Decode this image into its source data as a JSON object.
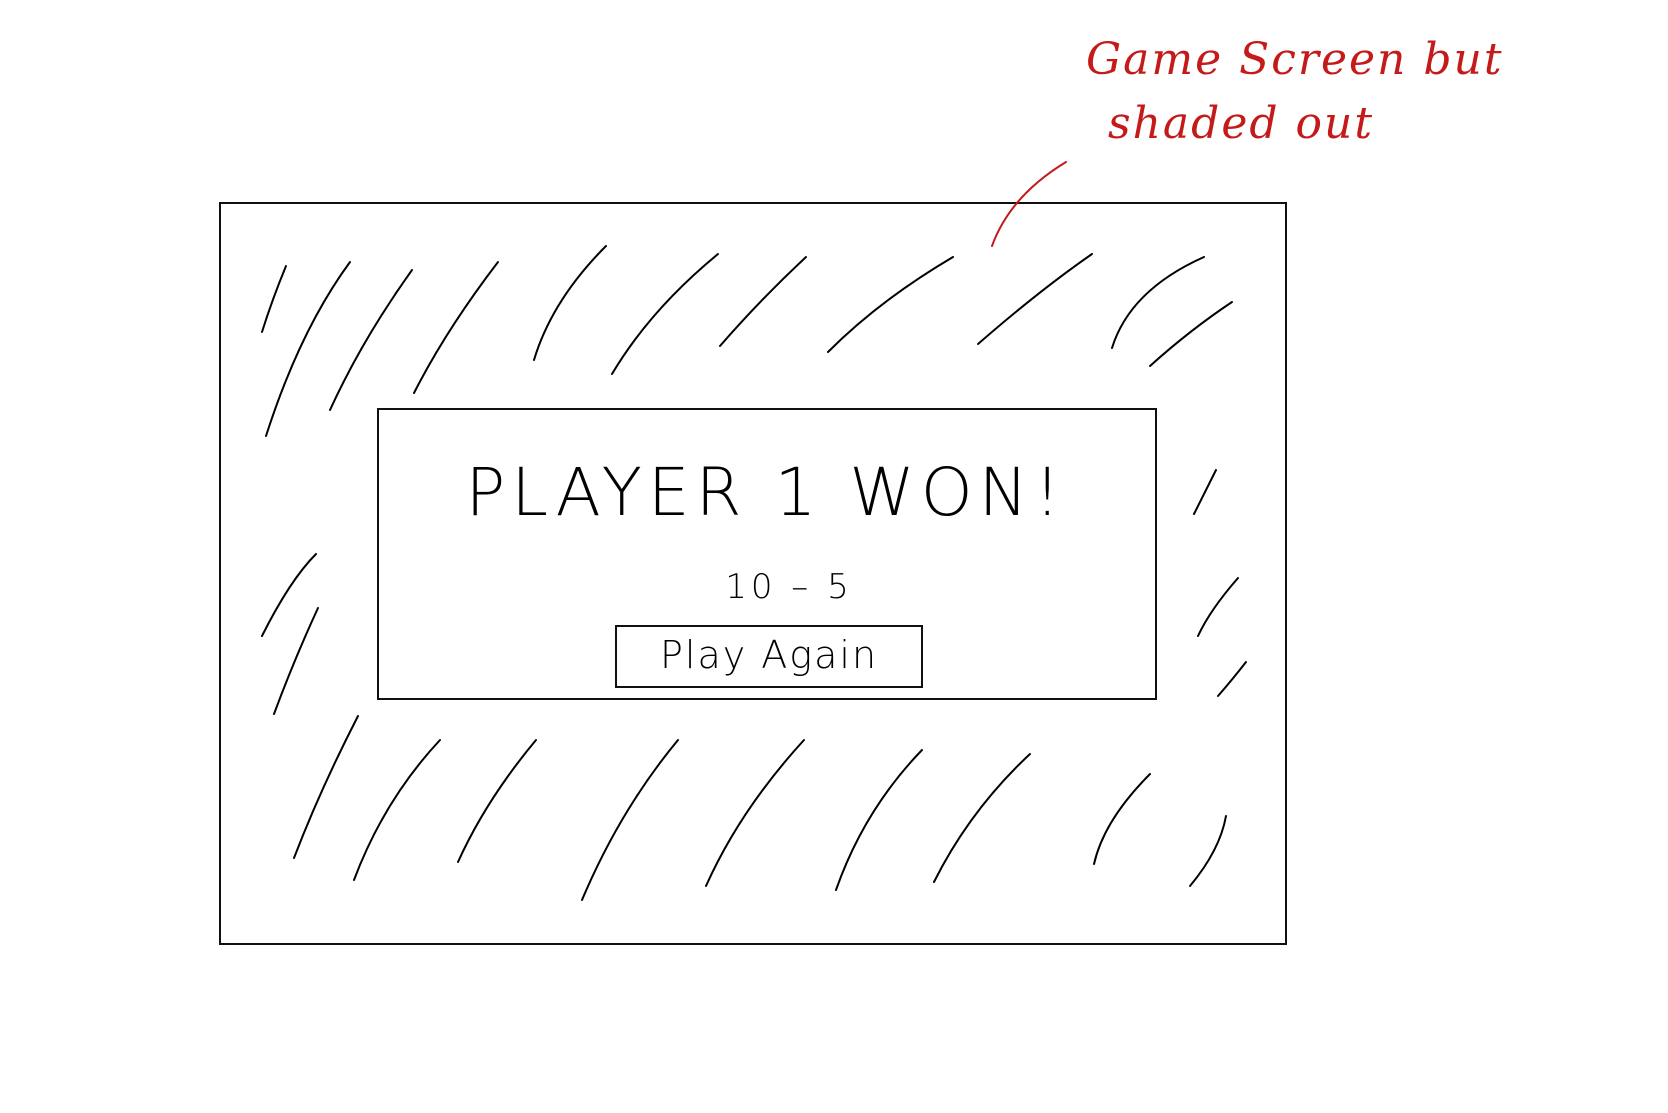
{
  "annotation": {
    "line1": "Game   Screen   but",
    "line2": "shaded   out",
    "color": "#c41a1a"
  },
  "win_dialog": {
    "title": "PLAYER 1   WON!",
    "score": "10 – 5",
    "button_label": "Play Again"
  },
  "ink_color": "#000000"
}
